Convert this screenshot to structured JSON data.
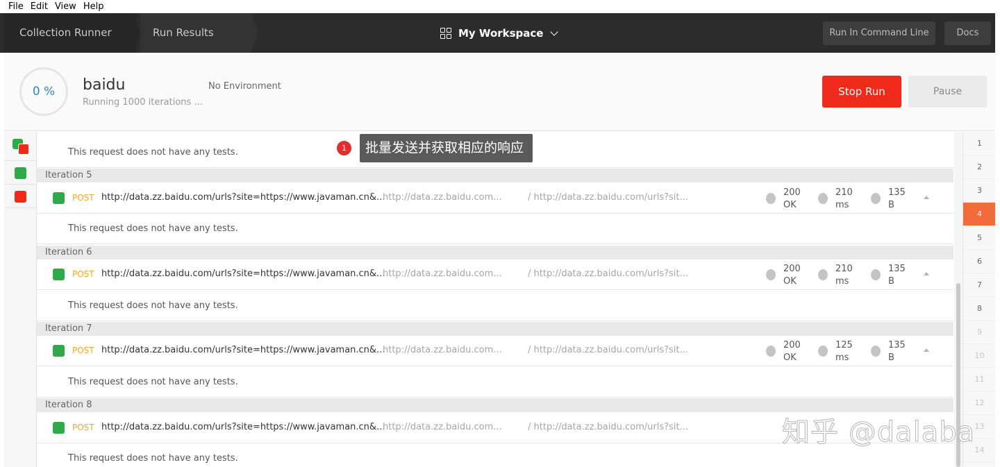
{
  "menu": [
    "File",
    "Edit",
    "View",
    "Help"
  ],
  "topbar": {
    "crumbs": [
      "Collection Runner",
      "Run Results"
    ],
    "workspace": "My Workspace",
    "run_cli_label": "Run In Command Line",
    "docs_label": "Docs"
  },
  "run": {
    "progress": "0 %",
    "collection": "baidu",
    "status": "Running 1000 iterations ...",
    "environment": "No Environment",
    "stop_label": "Stop Run",
    "pause_label": "Pause"
  },
  "annotation": {
    "badge": "1",
    "text": "批量发送并获取相应的响应"
  },
  "no_tests_text": "This request does not have any tests.",
  "iterations": [
    {
      "label": "Iteration 5",
      "method": "POST",
      "url": "http://data.zz.baidu.com/urls?site=https://www.javaman.cn&...",
      "host": "http://data.zz.baidu.com...",
      "path": "/ http://data.zz.baidu.com/urls?sit...",
      "code": "200",
      "code_text": "OK",
      "time": "210",
      "time_unit": "ms",
      "size": "135",
      "size_unit": "B"
    },
    {
      "label": "Iteration 6",
      "method": "POST",
      "url": "http://data.zz.baidu.com/urls?site=https://www.javaman.cn&...",
      "host": "http://data.zz.baidu.com...",
      "path": "/ http://data.zz.baidu.com/urls?sit...",
      "code": "200",
      "code_text": "OK",
      "time": "210",
      "time_unit": "ms",
      "size": "135",
      "size_unit": "B"
    },
    {
      "label": "Iteration 7",
      "method": "POST",
      "url": "http://data.zz.baidu.com/urls?site=https://www.javaman.cn&...",
      "host": "http://data.zz.baidu.com...",
      "path": "/ http://data.zz.baidu.com/urls?sit...",
      "code": "200",
      "code_text": "OK",
      "time": "125",
      "time_unit": "ms",
      "size": "135",
      "size_unit": "B"
    },
    {
      "label": "Iteration 8",
      "method": "POST",
      "url": "http://data.zz.baidu.com/urls?site=https://www.javaman.cn&...",
      "host": "http://data.zz.baidu.com...",
      "path": "/ http://data.zz.baidu.com/urls?sit..."
    }
  ],
  "iteration_numbers": [
    "1",
    "2",
    "3",
    "4",
    "5",
    "6",
    "7",
    "8",
    "9",
    "10",
    "11",
    "12",
    "13",
    "14"
  ],
  "active_iteration": "4",
  "watermark": "知乎 @dalaba",
  "colors": {
    "pass": "#2faa4a",
    "fail": "#ef2a1b",
    "active": "#f26b3a",
    "method_post": "#f5a623"
  }
}
